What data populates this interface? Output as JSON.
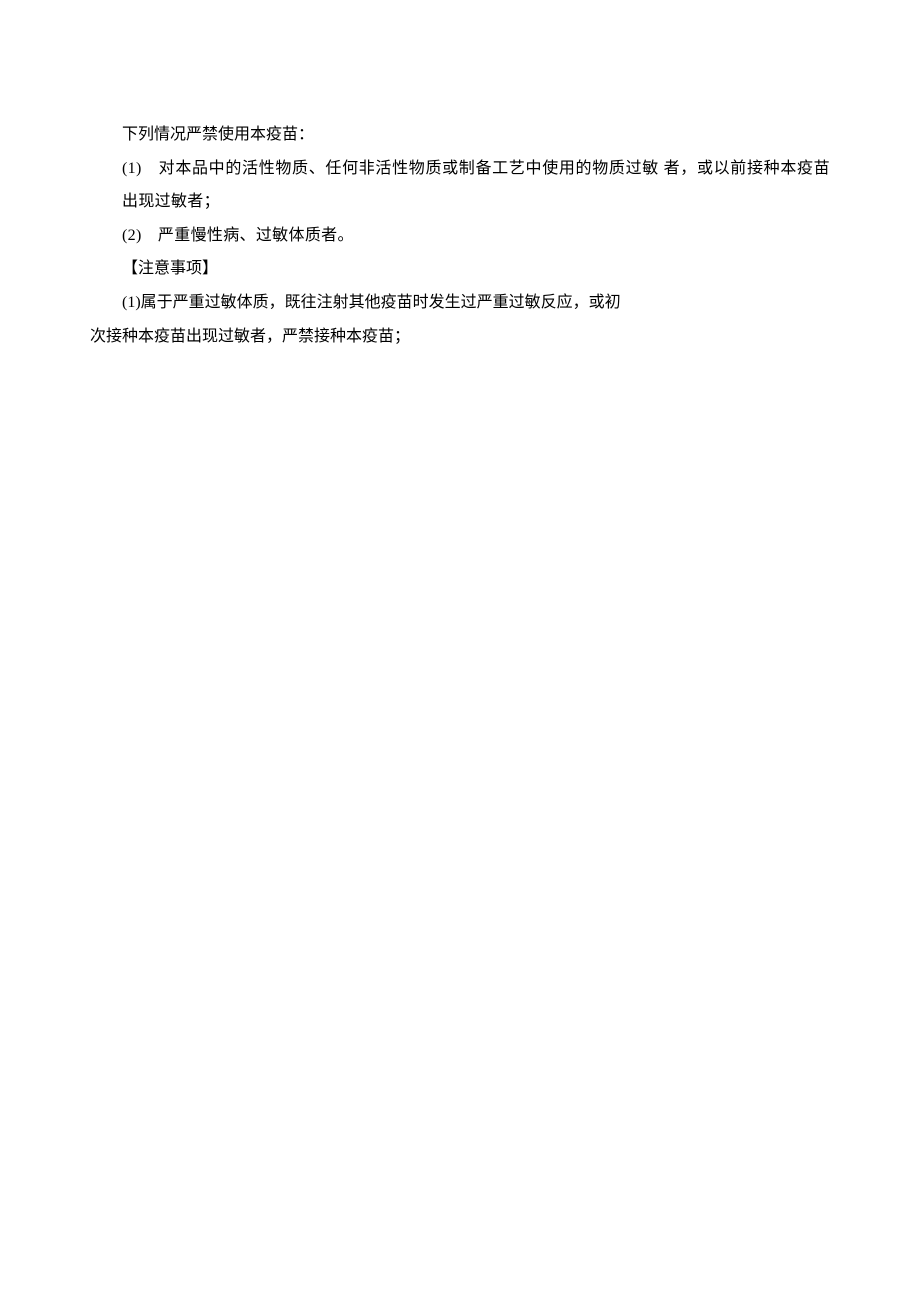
{
  "document": {
    "intro": "下列情况严禁使用本疫苗：",
    "items": [
      "(1)　对本品中的活性物质、任何非活性物质或制备工艺中使用的物质过敏 者，或以前接种本疫苗出现过敏者；",
      "(2)　严重慢性病、过敏体质者。"
    ],
    "precautions_header": "【注意事项】",
    "precautions_item1_line1": "(1)属于严重过敏体质，既往注射其他疫苗时发生过严重过敏反应，或初",
    "precautions_item1_line2": "次接种本疫苗出现过敏者，严禁接种本疫苗；"
  }
}
